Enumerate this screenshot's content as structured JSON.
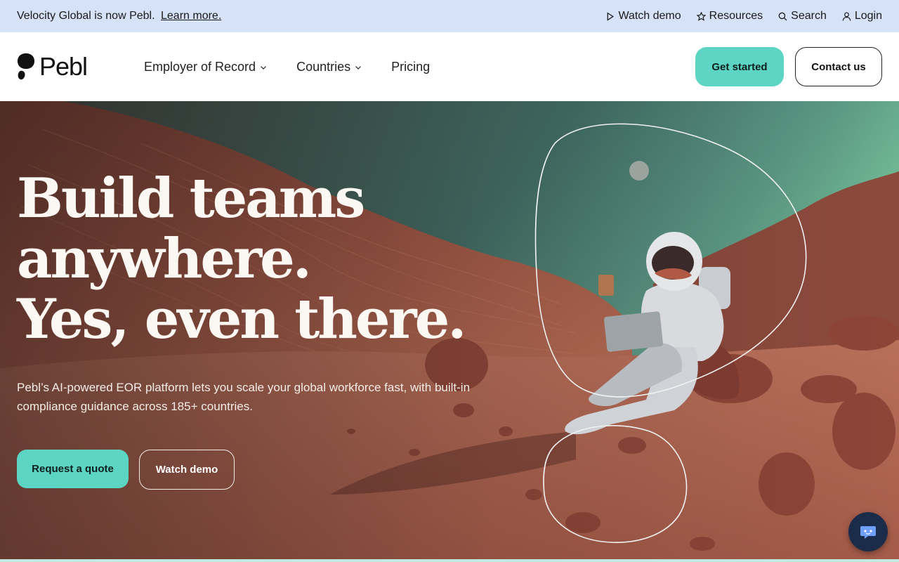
{
  "announcement": {
    "message": "Velocity Global is now Pebl.",
    "link": "Learn more.",
    "utility": {
      "watch_demo": "Watch demo",
      "resources": "Resources",
      "search": "Search",
      "login": "Login"
    }
  },
  "nav": {
    "logo_text": "Pebl",
    "links": [
      {
        "label": "Employer of Record",
        "has_dropdown": true
      },
      {
        "label": "Countries",
        "has_dropdown": true
      },
      {
        "label": "Pricing",
        "has_dropdown": false
      }
    ],
    "get_started": "Get started",
    "contact_us": "Contact us"
  },
  "hero": {
    "title_lines": [
      "Build teams",
      "anywhere.",
      "Yes, even there."
    ],
    "subtitle": "Pebl’s AI-powered EOR platform lets you scale your global workforce fast, with built-in compliance guidance across 185+ countries.",
    "primary_cta": "Request a quote",
    "secondary_cta": "Watch demo"
  },
  "colors": {
    "announcement_bg": "#d5e2f7",
    "accent_teal": "#5dd5c4",
    "terrain": "#b5634a",
    "sky": "#4e8a7e"
  },
  "icons": [
    "play-icon",
    "star-icon",
    "search-icon",
    "user-icon",
    "chevron-down-icon",
    "chat-icon"
  ]
}
